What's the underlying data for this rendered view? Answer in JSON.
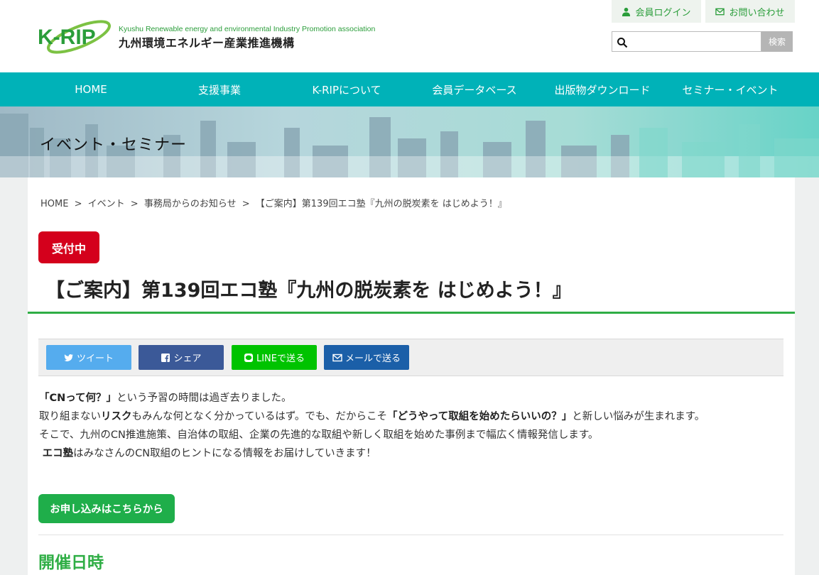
{
  "header": {
    "logo_text": "K-RIP",
    "org_name_en": "Kyushu Renewable energy and environmental Industry Promotion association",
    "org_name_ja": "九州環境エネルギー産業推進機構",
    "login_label": "会員ログイン",
    "contact_label": "お問い合わせ",
    "search_placeholder": "",
    "search_button_label": "検索"
  },
  "nav": {
    "items": [
      "HOME",
      "支援事業",
      "K-RIPについて",
      "会員データベース",
      "出版物ダウンロード",
      "セミナー・イベント"
    ]
  },
  "hero": {
    "title": "イベント・セミナー"
  },
  "breadcrumb": {
    "items": [
      "HOME",
      "イベント",
      "事務局からのお知らせ",
      "【ご案内】第139回エコ塾『九州の脱炭素を はじめよう！』"
    ],
    "separator": ">"
  },
  "article": {
    "status_badge": "受付中",
    "title": "【ご案内】第139回エコ塾『九州の脱炭素を はじめよう！』",
    "share": {
      "tweet": "ツイート",
      "facebook": "シェア",
      "line": "LINEで送る",
      "mail": "メールで送る"
    },
    "intro": {
      "l1_b": "「CNって何？」",
      "l1_t": "という予習の時間は過ぎ去りました。",
      "l2_a": "取り組まない",
      "l2_b": "リスク",
      "l2_c": "もみんな何となく分かっているはず。でも、だからこそ",
      "l2_d": "「どうやって取組を始めたらいいの？」",
      "l2_e": "と新しい悩みが生まれます。",
      "l3": "そこで、九州のCN推進施策、自治体の取組、企業の先進的な取組や新しく取組を始めた事例まで幅広く情報発信します。",
      "l4_b": "エコ塾",
      "l4_t": "はみなさんのCN取組のヒントになる情報をお届けしていきます！"
    },
    "apply_button": "お申し込みはこちらから",
    "section_title": "開催日時"
  },
  "colors": {
    "brand_green": "#2fae45",
    "nav_teal": "#00b2b8",
    "badge_red": "#d4001c",
    "twitter": "#55acee",
    "facebook": "#3b5998",
    "line": "#00c300",
    "mail": "#1b5fa8"
  },
  "icons": {
    "login": "user-icon",
    "contact": "envelope-icon",
    "search": "search-icon",
    "tweet": "twitter-bird-icon",
    "facebook": "facebook-icon",
    "line": "line-icon",
    "mail": "envelope-icon"
  }
}
